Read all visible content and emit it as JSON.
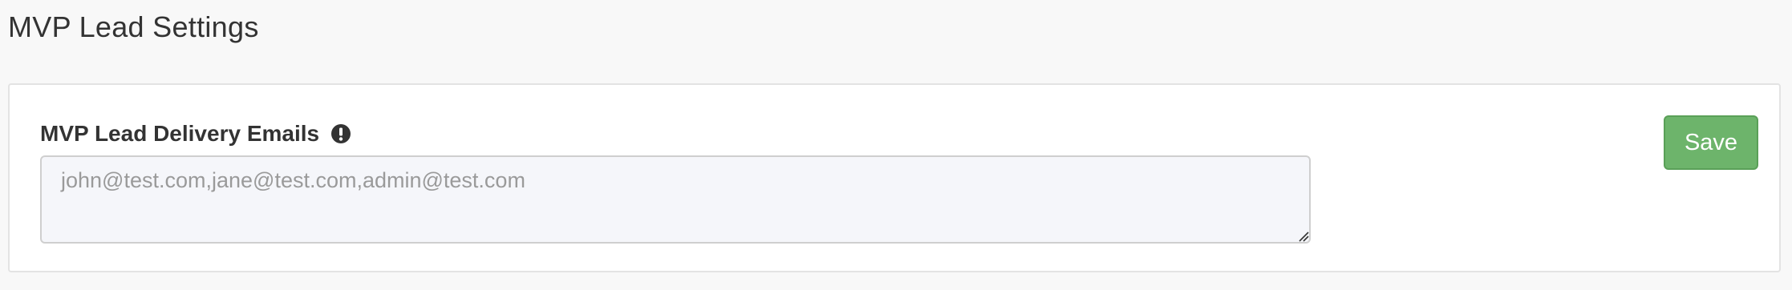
{
  "page": {
    "title": "MVP Lead Settings"
  },
  "form": {
    "field_label": "MVP Lead Delivery Emails",
    "info_icon": "exclamation-circle-icon",
    "emails_placeholder": "john@test.com,jane@test.com,admin@test.com",
    "emails_value": "",
    "save_label": "Save"
  },
  "colors": {
    "background": "#f8f8f8",
    "card": "#ffffff",
    "save_button": "#6db46b",
    "textarea_bg": "#f5f6fa",
    "text": "#333333"
  }
}
